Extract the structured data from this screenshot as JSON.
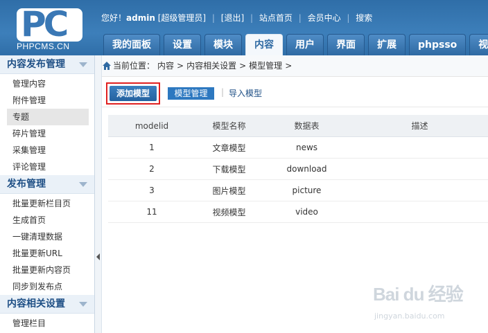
{
  "logo": {
    "mark": "PC",
    "brand": "PHPCMS.CN"
  },
  "topbar": {
    "greeting": "您好！",
    "user": "admin",
    "role": "[超级管理员]",
    "logout": "[退出]",
    "site_home": "站点首页",
    "member_center": "会员中心",
    "search": "搜索"
  },
  "tabs": [
    "我的面板",
    "设置",
    "模块",
    "内容",
    "用户",
    "界面",
    "扩展",
    "phpsso",
    "视频"
  ],
  "active_tab": "内容",
  "sidebar": {
    "sections": [
      {
        "title": "内容发布管理",
        "items": [
          "管理内容",
          "附件管理",
          "专题",
          "碎片管理",
          "采集管理",
          "评论管理"
        ]
      },
      {
        "title": "发布管理",
        "items": [
          "批量更新栏目页",
          "生成首页",
          "一键清理数据",
          "批量更新URL",
          "批量更新内容页",
          "同步到发布点"
        ]
      },
      {
        "title": "内容相关设置",
        "items": [
          "管理栏目"
        ]
      }
    ],
    "active_item": "专题"
  },
  "breadcrumb": {
    "label": "当前位置：",
    "path": [
      "内容",
      ">",
      "内容相关设置",
      ">",
      "模型管理",
      ">"
    ]
  },
  "actions": {
    "add_model": "添加模型",
    "model_manage": "模型管理",
    "separator": "|",
    "import_model": "导入模型"
  },
  "table": {
    "headers": [
      "modelid",
      "模型名称",
      "数据表",
      "描述"
    ],
    "rows": [
      [
        "1",
        "文章模型",
        "news",
        ""
      ],
      [
        "2",
        "下载模型",
        "download",
        ""
      ],
      [
        "3",
        "图片模型",
        "picture",
        ""
      ],
      [
        "11",
        "视频模型",
        "video",
        ""
      ]
    ]
  },
  "watermark": {
    "main": "Bai du 经验",
    "sub": "jingyan.baidu.com"
  }
}
